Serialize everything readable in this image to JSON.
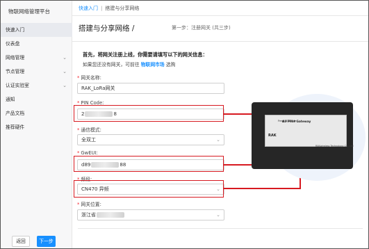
{
  "app": {
    "title": "物联网络管理平台"
  },
  "sidebar": {
    "items": [
      {
        "label": "快速入门",
        "active": true
      },
      {
        "label": "仪表盘"
      },
      {
        "label": "网络管理",
        "chevron": "chevron-down-icon"
      },
      {
        "label": "节点管理",
        "chevron": "chevron-down-icon"
      },
      {
        "label": "认证实验室",
        "chevron": "chevron-down-icon"
      },
      {
        "label": "通知"
      },
      {
        "label": "产品文档"
      },
      {
        "label": "推荐硬件"
      }
    ]
  },
  "breadcrumb": {
    "root": "快速入门",
    "separator": "|",
    "current": "搭建与分享网络"
  },
  "page": {
    "title": "搭建与分享网络 /",
    "subtitle": "第一步：注册网关 (共三步)"
  },
  "intro": {
    "line1": "首先，将网关注册上线，你需要请填写以下的网关信息：",
    "line2_prefix": "如果您还没有网关，可前往",
    "line2_link": "物联网市场",
    "line2_suffix": "选购"
  },
  "form": {
    "gateway_name": {
      "label": "网关名称:",
      "value": "RAK_LoRa网关"
    },
    "pin_code": {
      "label": "PIN Code:",
      "value_prefix": "2",
      "value_suffix": "8"
    },
    "comm_mode": {
      "label": "通信模式:",
      "value": "全双工"
    },
    "gweui": {
      "label": "GwEUI:",
      "value_prefix": "d89",
      "value_suffix": "88"
    },
    "band": {
      "label": "频段:",
      "value": "CN470 异频"
    },
    "location": {
      "label": "网关位置:",
      "value": "浙江省"
    }
  },
  "buttons": {
    "back": "返回",
    "next": "下一步"
  },
  "device": {
    "sticker_title": "All Pilot Gateway",
    "brand": "RAK",
    "freq": "Freq: 470MHz",
    "caption": "RAKwireless Technology Co., Ltd"
  },
  "colors": {
    "accent": "#1890ff",
    "highlight": "#d71920",
    "required": "#f5222d"
  }
}
